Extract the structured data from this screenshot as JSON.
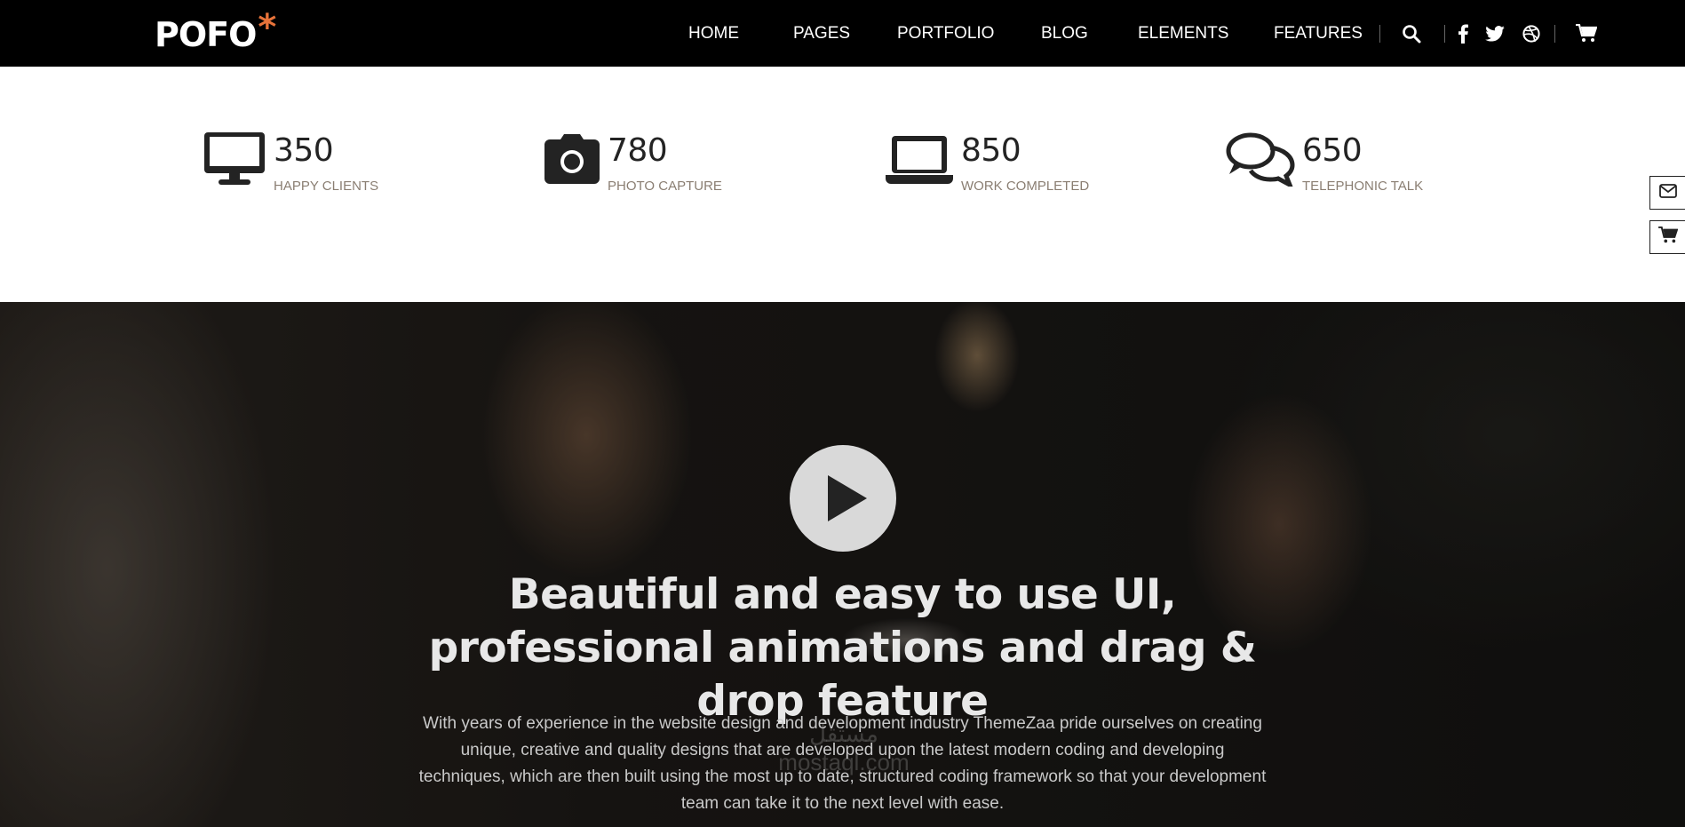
{
  "header": {
    "logo_text": "POFO",
    "logo_mark": "*",
    "accent_color": "#e8733a",
    "nav": [
      "HOME",
      "PAGES",
      "PORTFOLIO",
      "BLOG",
      "ELEMENTS",
      "FEATURES"
    ],
    "icons": [
      "search-icon",
      "facebook-icon",
      "twitter-icon",
      "dribbble-icon",
      "cart-icon"
    ]
  },
  "stats": [
    {
      "icon": "desktop-icon",
      "value": "350",
      "label": "HAPPY CLIENTS"
    },
    {
      "icon": "camera-icon",
      "value": "780",
      "label": "PHOTO CAPTURE"
    },
    {
      "icon": "laptop-icon",
      "value": "850",
      "label": "WORK COMPLETED"
    },
    {
      "icon": "chat-bubbles-icon",
      "value": "650",
      "label": "TELEPHONIC TALK"
    }
  ],
  "side_widgets": [
    "envelope-icon",
    "cart-icon"
  ],
  "hero": {
    "title": "Beautiful and easy to use UI, professional animations and drag & drop feature",
    "text": "With years of experience in the website design and development industry ThemeZaa pride ourselves on creating unique, creative and quality designs that are developed upon the latest modern coding and developing techniques, which are then built using the most up to date, structured coding framework so that your development team can take it to the next level with ease.",
    "watermark_line1": "مستقل",
    "watermark_line2": "mostaql.com"
  }
}
